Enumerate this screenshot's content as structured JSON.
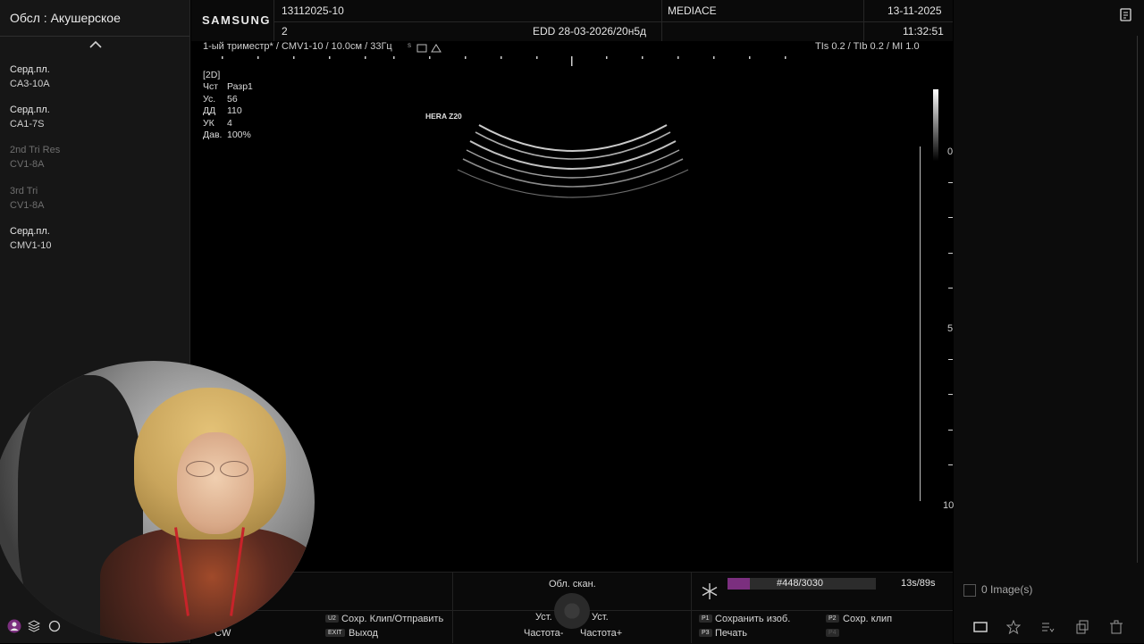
{
  "sidebar": {
    "title": "Обсл : Акушерское",
    "presets": [
      {
        "name": "Серд.пл.",
        "probe": "CA3-10A",
        "dim": false
      },
      {
        "name": "Серд.пл.",
        "probe": "CA1-7S",
        "dim": false
      },
      {
        "name": "2nd Tri Res",
        "probe": "CV1-8A",
        "dim": true
      },
      {
        "name": "3rd Tri",
        "probe": "CV1-8A",
        "dim": true
      },
      {
        "name": "Серд.пл.",
        "probe": "CMV1-10",
        "dim": false
      }
    ]
  },
  "header": {
    "logo": "SAMSUNG",
    "patient_id": "13112025-10",
    "patient_num": "2",
    "edd": "EDD 28-03-2026/20н5д",
    "institution": "MEDIACE",
    "date": "13-11-2025",
    "time": "11:32:51"
  },
  "imaging": {
    "info_line": "1-ый триместр* / CMV1-10 / 10.0см / 33Гц",
    "tis": "TIs   0.2 / TIb   0.2 / MI     1.0",
    "mode": "[2D]",
    "params": [
      {
        "label": "Чст",
        "value": "Разр1"
      },
      {
        "label": "Ус.",
        "value": "56"
      },
      {
        "label": "ДД",
        "value": "110"
      },
      {
        "label": "УК",
        "value": "4"
      },
      {
        "label": "Дав.",
        "value": "100%"
      }
    ],
    "brand": "HERA Z20",
    "depth_labels": [
      "0",
      "5",
      "10"
    ]
  },
  "bottom": {
    "scan_area": "Обл. скан.",
    "set_minus": "Уст.",
    "set_plus": "Уст.",
    "freq_minus": "Частота-",
    "freq_plus": "Частота+",
    "u2_key": "U2",
    "u2_label": "Сохр. Клип/Отправить",
    "exit_key": "EXIT",
    "exit_label": "Выход",
    "u3_label": "CW",
    "p1_key": "P1",
    "p1_label": "Сохранить изоб.",
    "p2_key": "P2",
    "p2_label": "Сохр. клип",
    "p3_key": "P3",
    "p3_label": "Печать",
    "p4_key": "P4",
    "cine_frame": "#448/3030",
    "cine_progress": 0.148,
    "cine_time": "13s/89s"
  },
  "right_panel": {
    "images_label": "0 Image(s)"
  },
  "colors": {
    "accent": "#7b2f7f",
    "sidebar_bg": "#161616"
  }
}
